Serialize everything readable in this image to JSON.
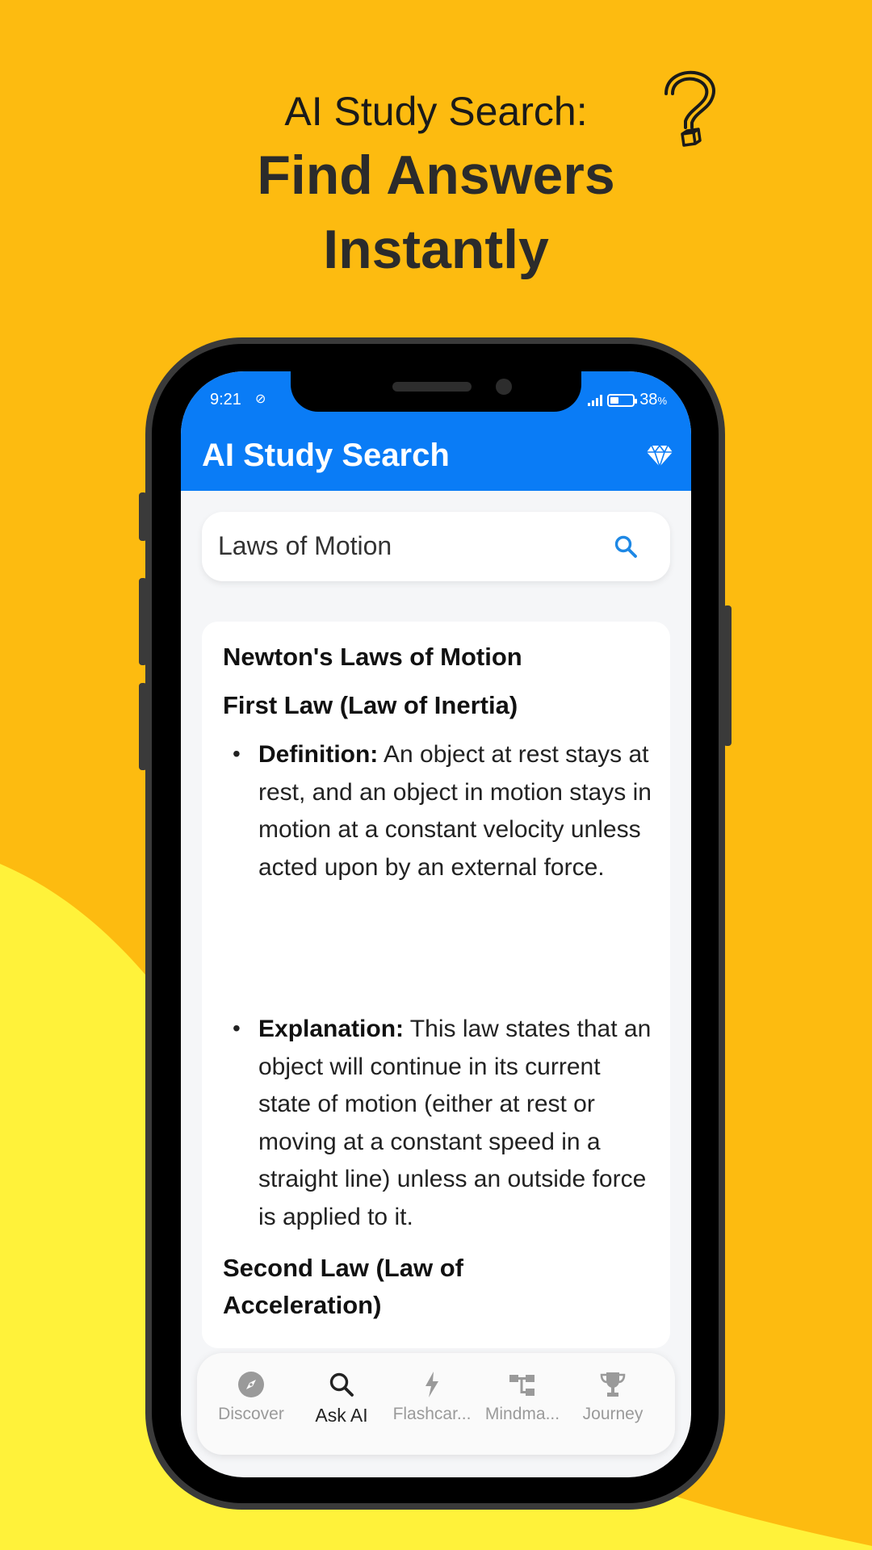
{
  "headline": {
    "subtitle": "AI Study Search:",
    "title_line1": "Find Answers",
    "title_line2": "Instantly"
  },
  "status_bar": {
    "time": "9:21",
    "battery_percent": "38",
    "percent_sign": "%",
    "battery_level": 0.38
  },
  "app_bar": {
    "title": "AI Study Search",
    "premium_icon": "gem-icon"
  },
  "search": {
    "value": "Laws of Motion",
    "icon": "search-icon"
  },
  "answer": {
    "heading": "Newton's Laws of Motion",
    "first_law": {
      "title": "First Law (Law of Inertia)",
      "bullets": [
        {
          "label": "Definition:",
          "text": " An object at rest stays at rest, and an object in motion stays in motion at a constant velocity unless acted upon by an external force."
        },
        {
          "label": "Explanation:",
          "text": " This law states that an object will continue in its current state of motion (either at rest or moving at a constant speed in a straight line) unless an outside force is applied to it."
        }
      ]
    },
    "second_law": {
      "title": "Second Law (Law of Acceleration)"
    }
  },
  "bottom_nav": {
    "items": [
      {
        "label": "Discover",
        "icon": "compass-icon"
      },
      {
        "label": "Ask AI",
        "icon": "search-icon"
      },
      {
        "label": "Flashcar...",
        "icon": "lightning-icon"
      },
      {
        "label": "Mindma...",
        "icon": "mindmap-icon"
      },
      {
        "label": "Journey",
        "icon": "trophy-icon"
      }
    ],
    "active_index": 1
  },
  "colors": {
    "background": "#FDBB10",
    "wave": "#FFF23A",
    "accent_blue": "#0A7CF6"
  }
}
